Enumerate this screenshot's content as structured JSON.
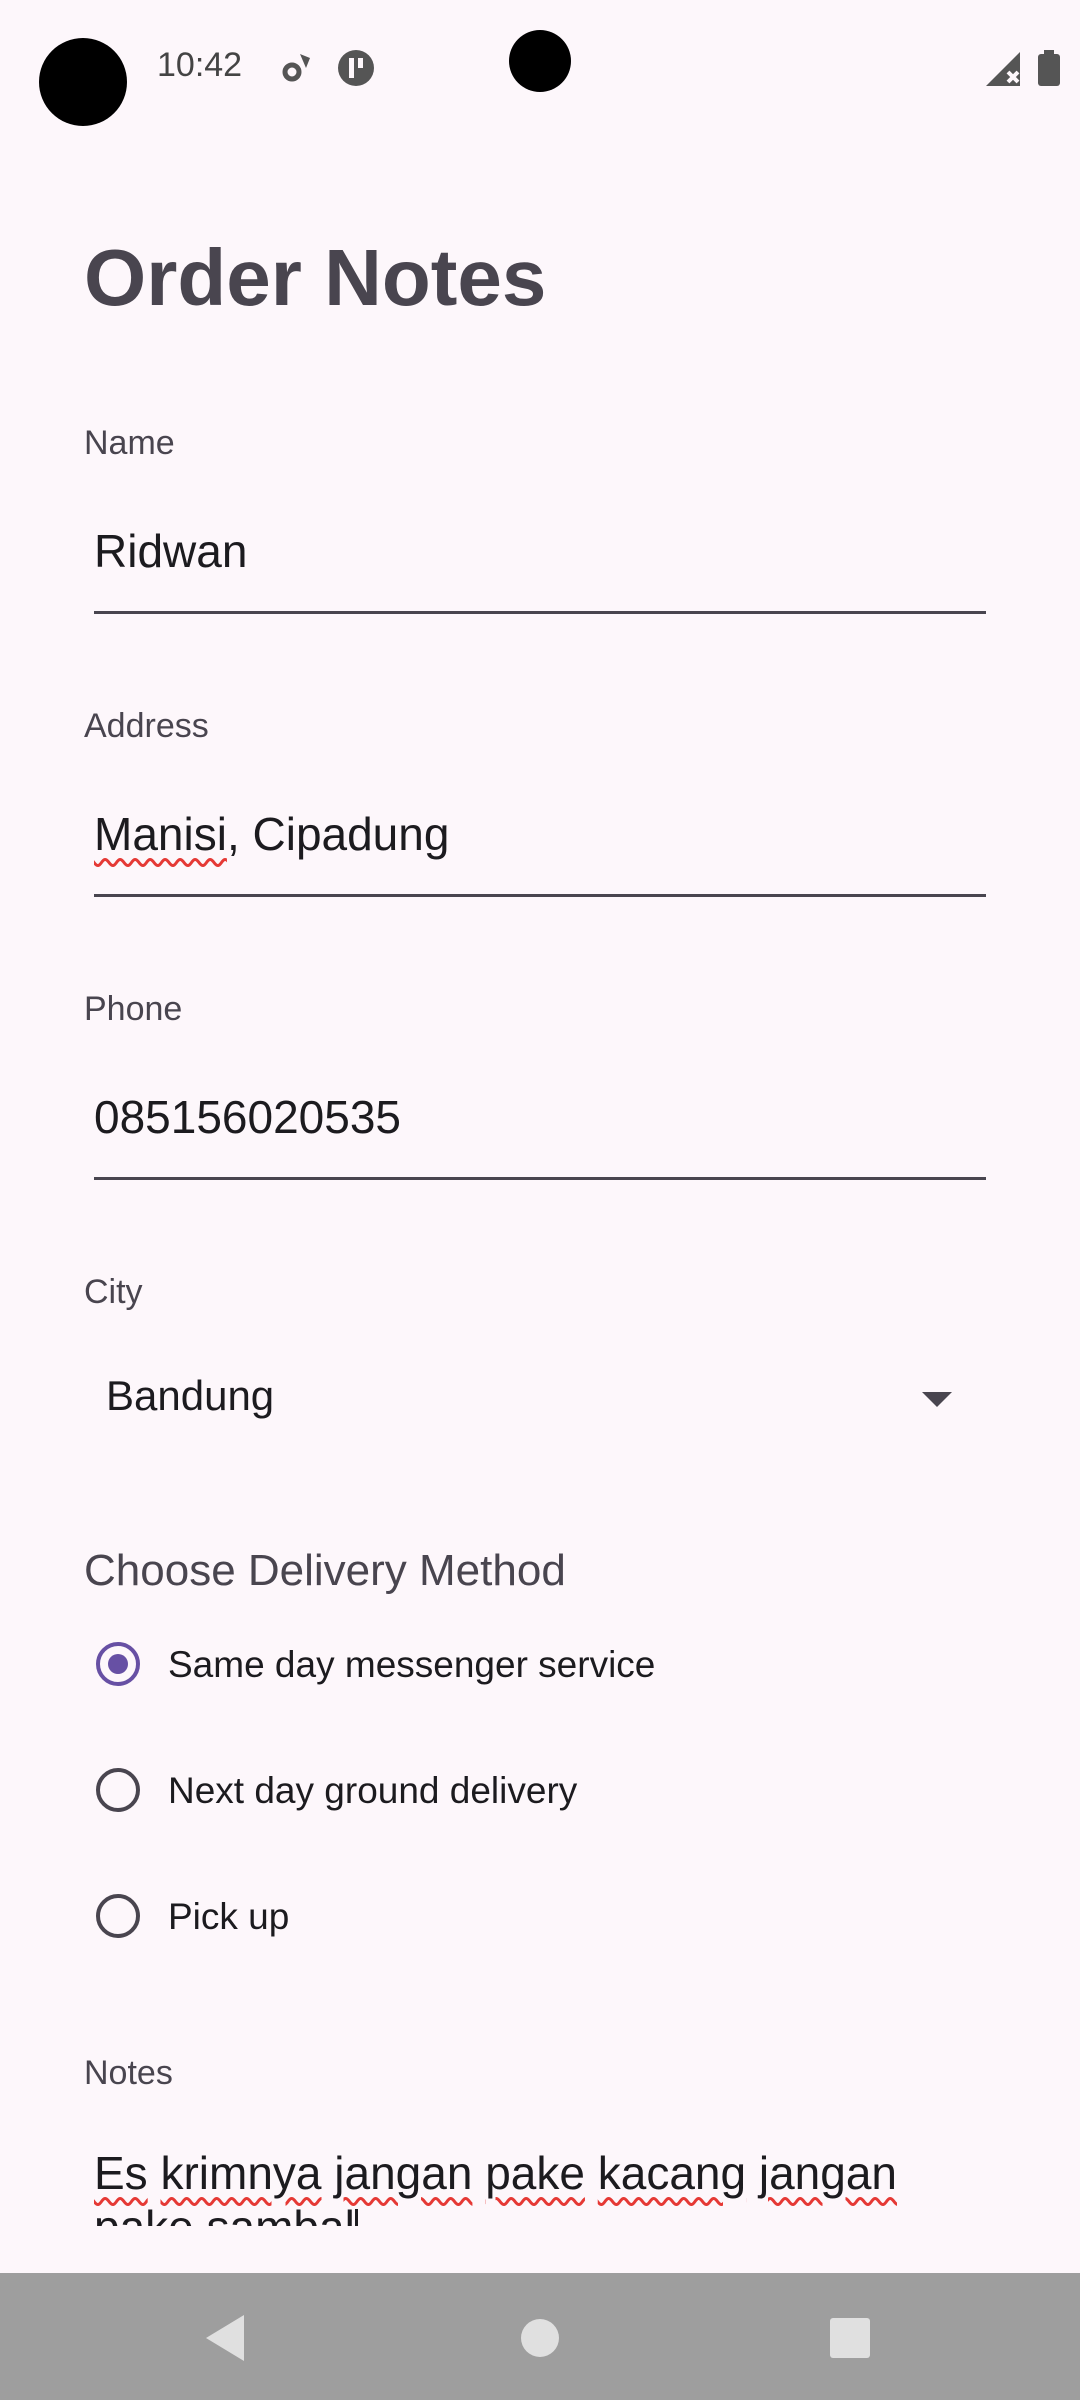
{
  "status_bar": {
    "time": "10:42",
    "icons": [
      "settings-sync-icon",
      "notification-icon",
      "signal-icon",
      "battery-icon"
    ]
  },
  "page": {
    "title": "Order Notes"
  },
  "form": {
    "name": {
      "label": "Name",
      "value": "Ridwan"
    },
    "address": {
      "label": "Address",
      "value_misspelled": "Manisi",
      "value_rest": ", Cipadung"
    },
    "phone": {
      "label": "Phone",
      "value": "085156020535"
    },
    "city": {
      "label": "City",
      "value": "Bandung"
    },
    "delivery": {
      "heading": "Choose Delivery Method",
      "options": [
        {
          "label": "Same day messenger service",
          "selected": true
        },
        {
          "label": "Next day ground delivery",
          "selected": false
        },
        {
          "label": "Pick up",
          "selected": false
        }
      ]
    },
    "notes": {
      "label": "Notes",
      "words": [
        "Es",
        "krimnya",
        "jangan",
        "pake",
        "kacang",
        "jangan",
        "pake",
        "sambal"
      ]
    }
  },
  "navigation": {
    "buttons": [
      "back-icon",
      "home-icon",
      "recents-icon"
    ]
  },
  "colors": {
    "background": "#fdf7fb",
    "accent": "#6750a4",
    "spellcheck": "#e53935",
    "nav_bar": "#9e9e9e"
  }
}
